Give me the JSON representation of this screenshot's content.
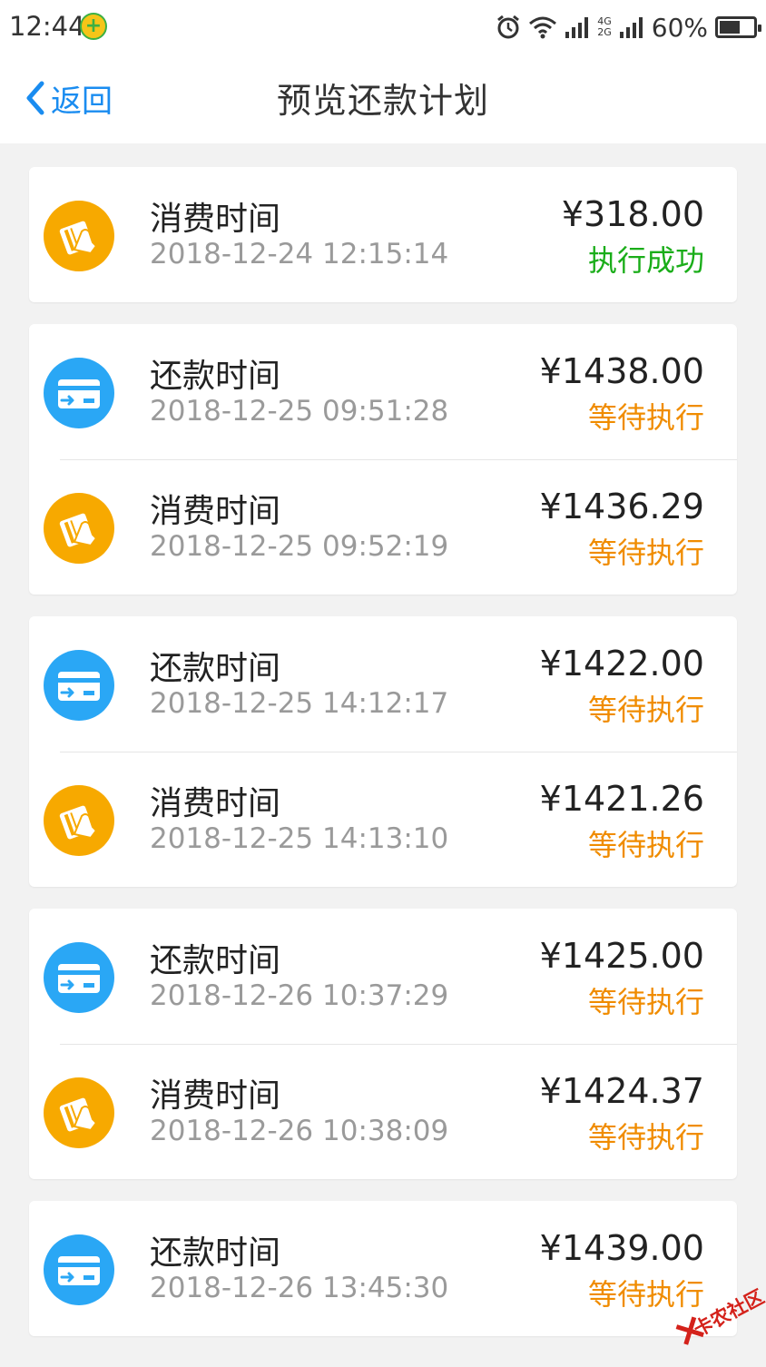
{
  "status_bar": {
    "time": "12:44",
    "network_top": "4G",
    "network_bottom": "2G",
    "battery": "60%",
    "battery_level": 0.6
  },
  "nav": {
    "back_label": "返回",
    "title": "预览还款计划"
  },
  "colors": {
    "accent": "#1a8cf0",
    "consume_icon_bg": "#f7a900",
    "repay_icon_bg": "#2aa7f5",
    "status_success": "#1aad19",
    "status_pending": "#f08c00"
  },
  "groups": [
    {
      "rows": [
        {
          "type": "consume",
          "icon": "hand-card-icon",
          "title": "消费时间",
          "time": "2018-12-24 12:15:14",
          "amount": "¥318.00",
          "status": "执行成功",
          "status_kind": "success"
        }
      ]
    },
    {
      "rows": [
        {
          "type": "repay",
          "icon": "card-transfer-icon",
          "title": "还款时间",
          "time": "2018-12-25 09:51:28",
          "amount": "¥1438.00",
          "status": "等待执行",
          "status_kind": "pending"
        },
        {
          "type": "consume",
          "icon": "hand-card-icon",
          "title": "消费时间",
          "time": "2018-12-25 09:52:19",
          "amount": "¥1436.29",
          "status": "等待执行",
          "status_kind": "pending"
        }
      ]
    },
    {
      "rows": [
        {
          "type": "repay",
          "icon": "card-transfer-icon",
          "title": "还款时间",
          "time": "2018-12-25 14:12:17",
          "amount": "¥1422.00",
          "status": "等待执行",
          "status_kind": "pending"
        },
        {
          "type": "consume",
          "icon": "hand-card-icon",
          "title": "消费时间",
          "time": "2018-12-25 14:13:10",
          "amount": "¥1421.26",
          "status": "等待执行",
          "status_kind": "pending"
        }
      ]
    },
    {
      "rows": [
        {
          "type": "repay",
          "icon": "card-transfer-icon",
          "title": "还款时间",
          "time": "2018-12-26 10:37:29",
          "amount": "¥1425.00",
          "status": "等待执行",
          "status_kind": "pending"
        },
        {
          "type": "consume",
          "icon": "hand-card-icon",
          "title": "消费时间",
          "time": "2018-12-26 10:38:09",
          "amount": "¥1424.37",
          "status": "等待执行",
          "status_kind": "pending"
        }
      ]
    },
    {
      "rows": [
        {
          "type": "repay",
          "icon": "card-transfer-icon",
          "title": "还款时间",
          "time": "2018-12-26 13:45:30",
          "amount": "¥1439.00",
          "status": "等待执行",
          "status_kind": "pending"
        }
      ]
    }
  ],
  "watermark": {
    "text": "卡农社区"
  }
}
